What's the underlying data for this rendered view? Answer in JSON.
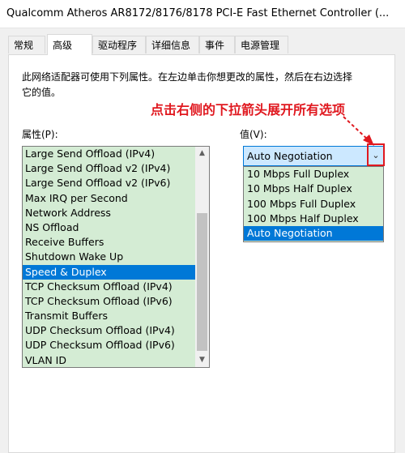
{
  "window": {
    "title": "Qualcomm Atheros AR8172/8176/8178 PCI-E Fast Ethernet Controller (..."
  },
  "tabs": [
    {
      "label": "常规"
    },
    {
      "label": "高级"
    },
    {
      "label": "驱动程序"
    },
    {
      "label": "详细信息"
    },
    {
      "label": "事件"
    },
    {
      "label": "电源管理"
    }
  ],
  "active_tab": "高级",
  "description": "此网络适配器可使用下列属性。在左边单击你想更改的属性，然后在右边选择它的值。",
  "annotation": "点击右侧的下拉箭头展开所有选项",
  "property_label": "属性(P):",
  "value_label": "值(V):",
  "properties": [
    "Large Send Offload (IPv4)",
    "Large Send Offload v2 (IPv4)",
    "Large Send Offload v2 (IPv6)",
    "Max IRQ per Second",
    "Network Address",
    "NS Offload",
    "Receive Buffers",
    "Shutdown Wake Up",
    "Speed & Duplex",
    "TCP Checksum Offload (IPv4)",
    "TCP Checksum Offload (IPv6)",
    "Transmit Buffers",
    "UDP Checksum Offload (IPv4)",
    "UDP Checksum Offload (IPv6)",
    "VLAN ID"
  ],
  "selected_property": "Speed & Duplex",
  "value_combo": {
    "selected": "Auto Negotiation"
  },
  "value_options": [
    "10 Mbps Full Duplex",
    "10 Mbps Half Duplex",
    "100 Mbps Full Duplex",
    "100 Mbps Half Duplex",
    "Auto Negotiation"
  ],
  "colors": {
    "annotation": "#e0181f",
    "selection": "#0078d7",
    "list_background": "#d4ecd4"
  },
  "icons": {
    "scroll_up": "chevron-up-icon",
    "scroll_down": "chevron-down-icon",
    "dropdown": "chevron-down-icon",
    "pointer": "arrow-icon"
  }
}
